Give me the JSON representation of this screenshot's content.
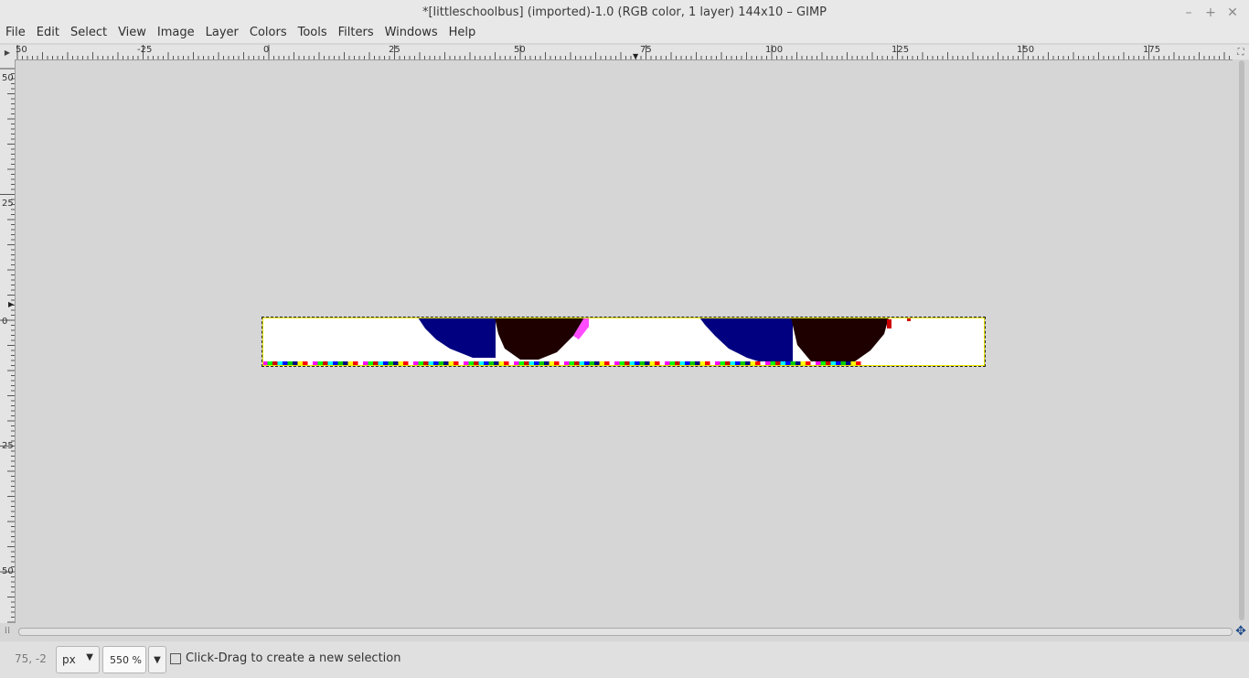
{
  "window": {
    "title": "*[littleschoolbus] (imported)-1.0 (RGB color, 1 layer) 144x10 – GIMP",
    "minimize": "–",
    "maximize": "+",
    "close": "✕"
  },
  "menu": [
    "File",
    "Edit",
    "Select",
    "View",
    "Image",
    "Layer",
    "Colors",
    "Tools",
    "Filters",
    "Windows",
    "Help"
  ],
  "hruler_labels": [
    "50",
    "-25",
    "0",
    "25",
    "50",
    "75",
    "100",
    "125",
    "150",
    "175"
  ],
  "vruler_labels": [
    "50",
    "25",
    "0",
    "25",
    "50"
  ],
  "status": {
    "coords": "75, -2",
    "unit": "px",
    "zoom": "550 %",
    "message": "Click-Drag to create a new selection"
  },
  "colors": {
    "canvas_bg": "#d6d6d6",
    "navy": "#000080",
    "dark_red": "#1e0000",
    "selection_dash": "#e8e800"
  }
}
